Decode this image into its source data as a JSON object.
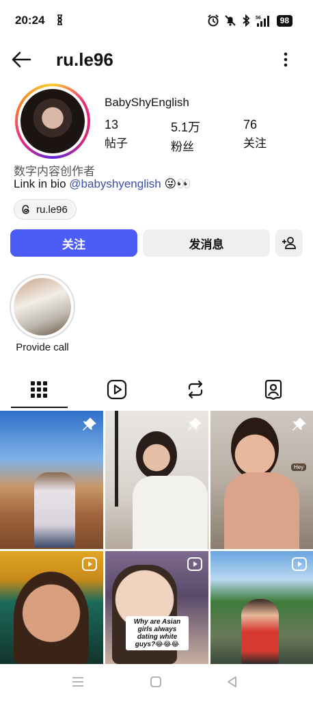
{
  "status_bar": {
    "time": "20:24",
    "network": "56",
    "battery": "98"
  },
  "header": {
    "username": "ru.le96",
    "back_icon": "arrow-left-icon",
    "more_icon": "more-vertical-icon"
  },
  "profile": {
    "display_name": "BabyShyEnglish",
    "stats": [
      {
        "value": "13",
        "label": "帖子"
      },
      {
        "value": "5.1万",
        "label": "粉丝"
      },
      {
        "value": "76",
        "label": "关注"
      }
    ],
    "category": "数字内容创作者",
    "bio_prefix": "Link in bio ",
    "bio_link": "@babyshyenglish",
    "bio_emoji": "😜👀",
    "threads_handle": "ru.le96"
  },
  "actions": {
    "follow_label": "关注",
    "message_label": "发消息",
    "follow_color": "#4b5cf7"
  },
  "highlights": [
    {
      "label": "Provide call"
    }
  ],
  "tabs": [
    {
      "name": "posts",
      "icon": "grid-icon",
      "active": true
    },
    {
      "name": "reels",
      "icon": "reels-icon",
      "active": false
    },
    {
      "name": "reposts",
      "icon": "repost-icon",
      "active": false
    },
    {
      "name": "tagged",
      "icon": "tagged-user-icon",
      "active": false
    }
  ],
  "grid": {
    "posts": [
      {
        "badge": "pin-icon"
      },
      {
        "badge": "pin-icon"
      },
      {
        "badge": "pin-icon",
        "tag": "Hey"
      },
      {
        "badge": "reel-icon"
      },
      {
        "badge": "reel-icon",
        "caption": "Why are Asian girls always dating white guys?😂😂😂"
      },
      {
        "badge": "reel-icon"
      }
    ]
  },
  "system_nav": {
    "icons": [
      "menu-icon",
      "home-square-icon",
      "back-triangle-icon"
    ]
  }
}
